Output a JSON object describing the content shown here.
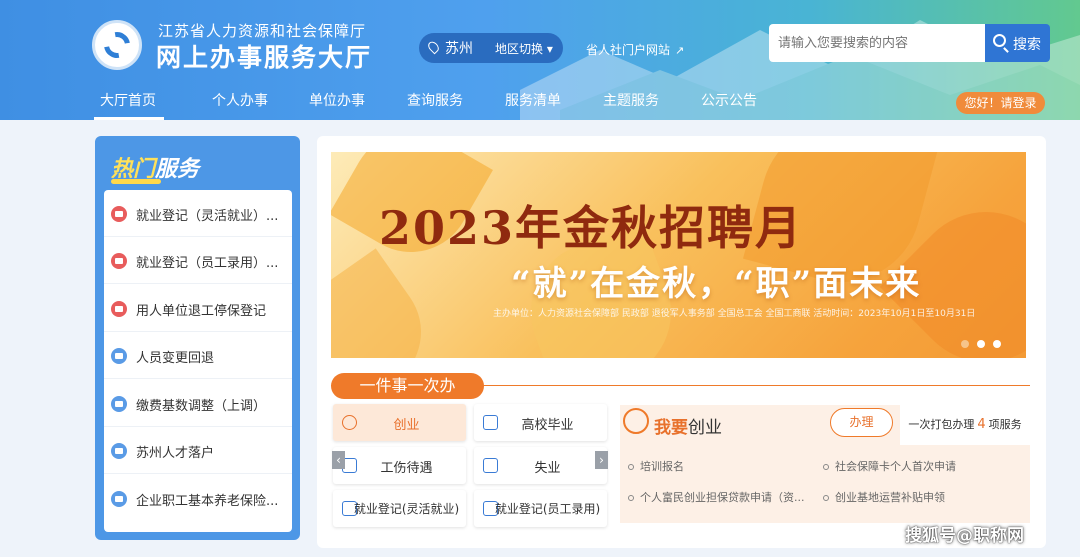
{
  "header": {
    "org_name": "江苏省人力资源和社会保障厅",
    "hall_title": "网上办事服务大厅",
    "city": "苏州",
    "region_switch": "地区切换",
    "portal_link": "省人社门户网站",
    "search_placeholder": "请输入您要搜索的内容",
    "search_button": "搜索",
    "login_button": "您好！请登录",
    "gradient_left": "#3f8fe3",
    "gradient_right": "#62c98f"
  },
  "nav": [
    "大厅首页",
    "个人办事",
    "单位办事",
    "查询服务",
    "服务清单",
    "主题服务",
    "公示公告"
  ],
  "hot": {
    "title_a": "热门",
    "title_b": "服务",
    "items": [
      {
        "label": "就业登记（灵活就业）...",
        "icon": "register-icon",
        "color": "#e85c5c"
      },
      {
        "label": "就业登记（员工录用）...",
        "icon": "register-icon",
        "color": "#e85c5c"
      },
      {
        "label": "用人单位退工停保登记",
        "icon": "unit-icon",
        "color": "#e85c5c"
      },
      {
        "label": "人员变更回退",
        "icon": "person-icon",
        "color": "#5a9be6"
      },
      {
        "label": "缴费基数调整（上调）",
        "icon": "payment-icon",
        "color": "#5a9be6"
      },
      {
        "label": "苏州人才落户",
        "icon": "home-icon",
        "color": "#5a9be6"
      },
      {
        "label": "企业职工基本养老保险...",
        "icon": "pension-icon",
        "color": "#5a9be6"
      }
    ]
  },
  "banner": {
    "title": "2023年金秋招聘月",
    "subtitle": "“就”在金秋，“职”面未来",
    "small_text": "主办单位：人力资源社会保障部 民政部 退役军人事务部 全国总工会 全国工商联   活动时间：2023年10月1日至10月31日"
  },
  "section": {
    "title": "一件事一次办",
    "tiles": [
      {
        "label": "创业",
        "icon": "startup-icon",
        "active": true
      },
      {
        "label": "高校毕业",
        "icon": "graduate-icon",
        "active": false
      },
      {
        "label": "工伤待遇",
        "icon": "injury-icon",
        "active": false
      },
      {
        "label": "失业",
        "icon": "unemployment-icon",
        "active": false
      },
      {
        "label": "就业登记(灵活就业)",
        "icon": "form-icon",
        "active": false
      },
      {
        "label": "就业登记(员工录用)",
        "icon": "form-icon",
        "active": false
      }
    ],
    "prev_arrow": "‹",
    "next_arrow": "›"
  },
  "detail": {
    "title_prefix": "我要",
    "title_suffix": "创业",
    "handle_button": "办理",
    "package_pre": "一次打包办理",
    "package_count": "4",
    "package_post": "项服务",
    "items": [
      "培训报名",
      "社会保障卡个人首次申请",
      "个人富民创业担保贷款申请（资...",
      "创业基地运营补贴申领"
    ]
  },
  "watermark": "搜狐号@职称网"
}
